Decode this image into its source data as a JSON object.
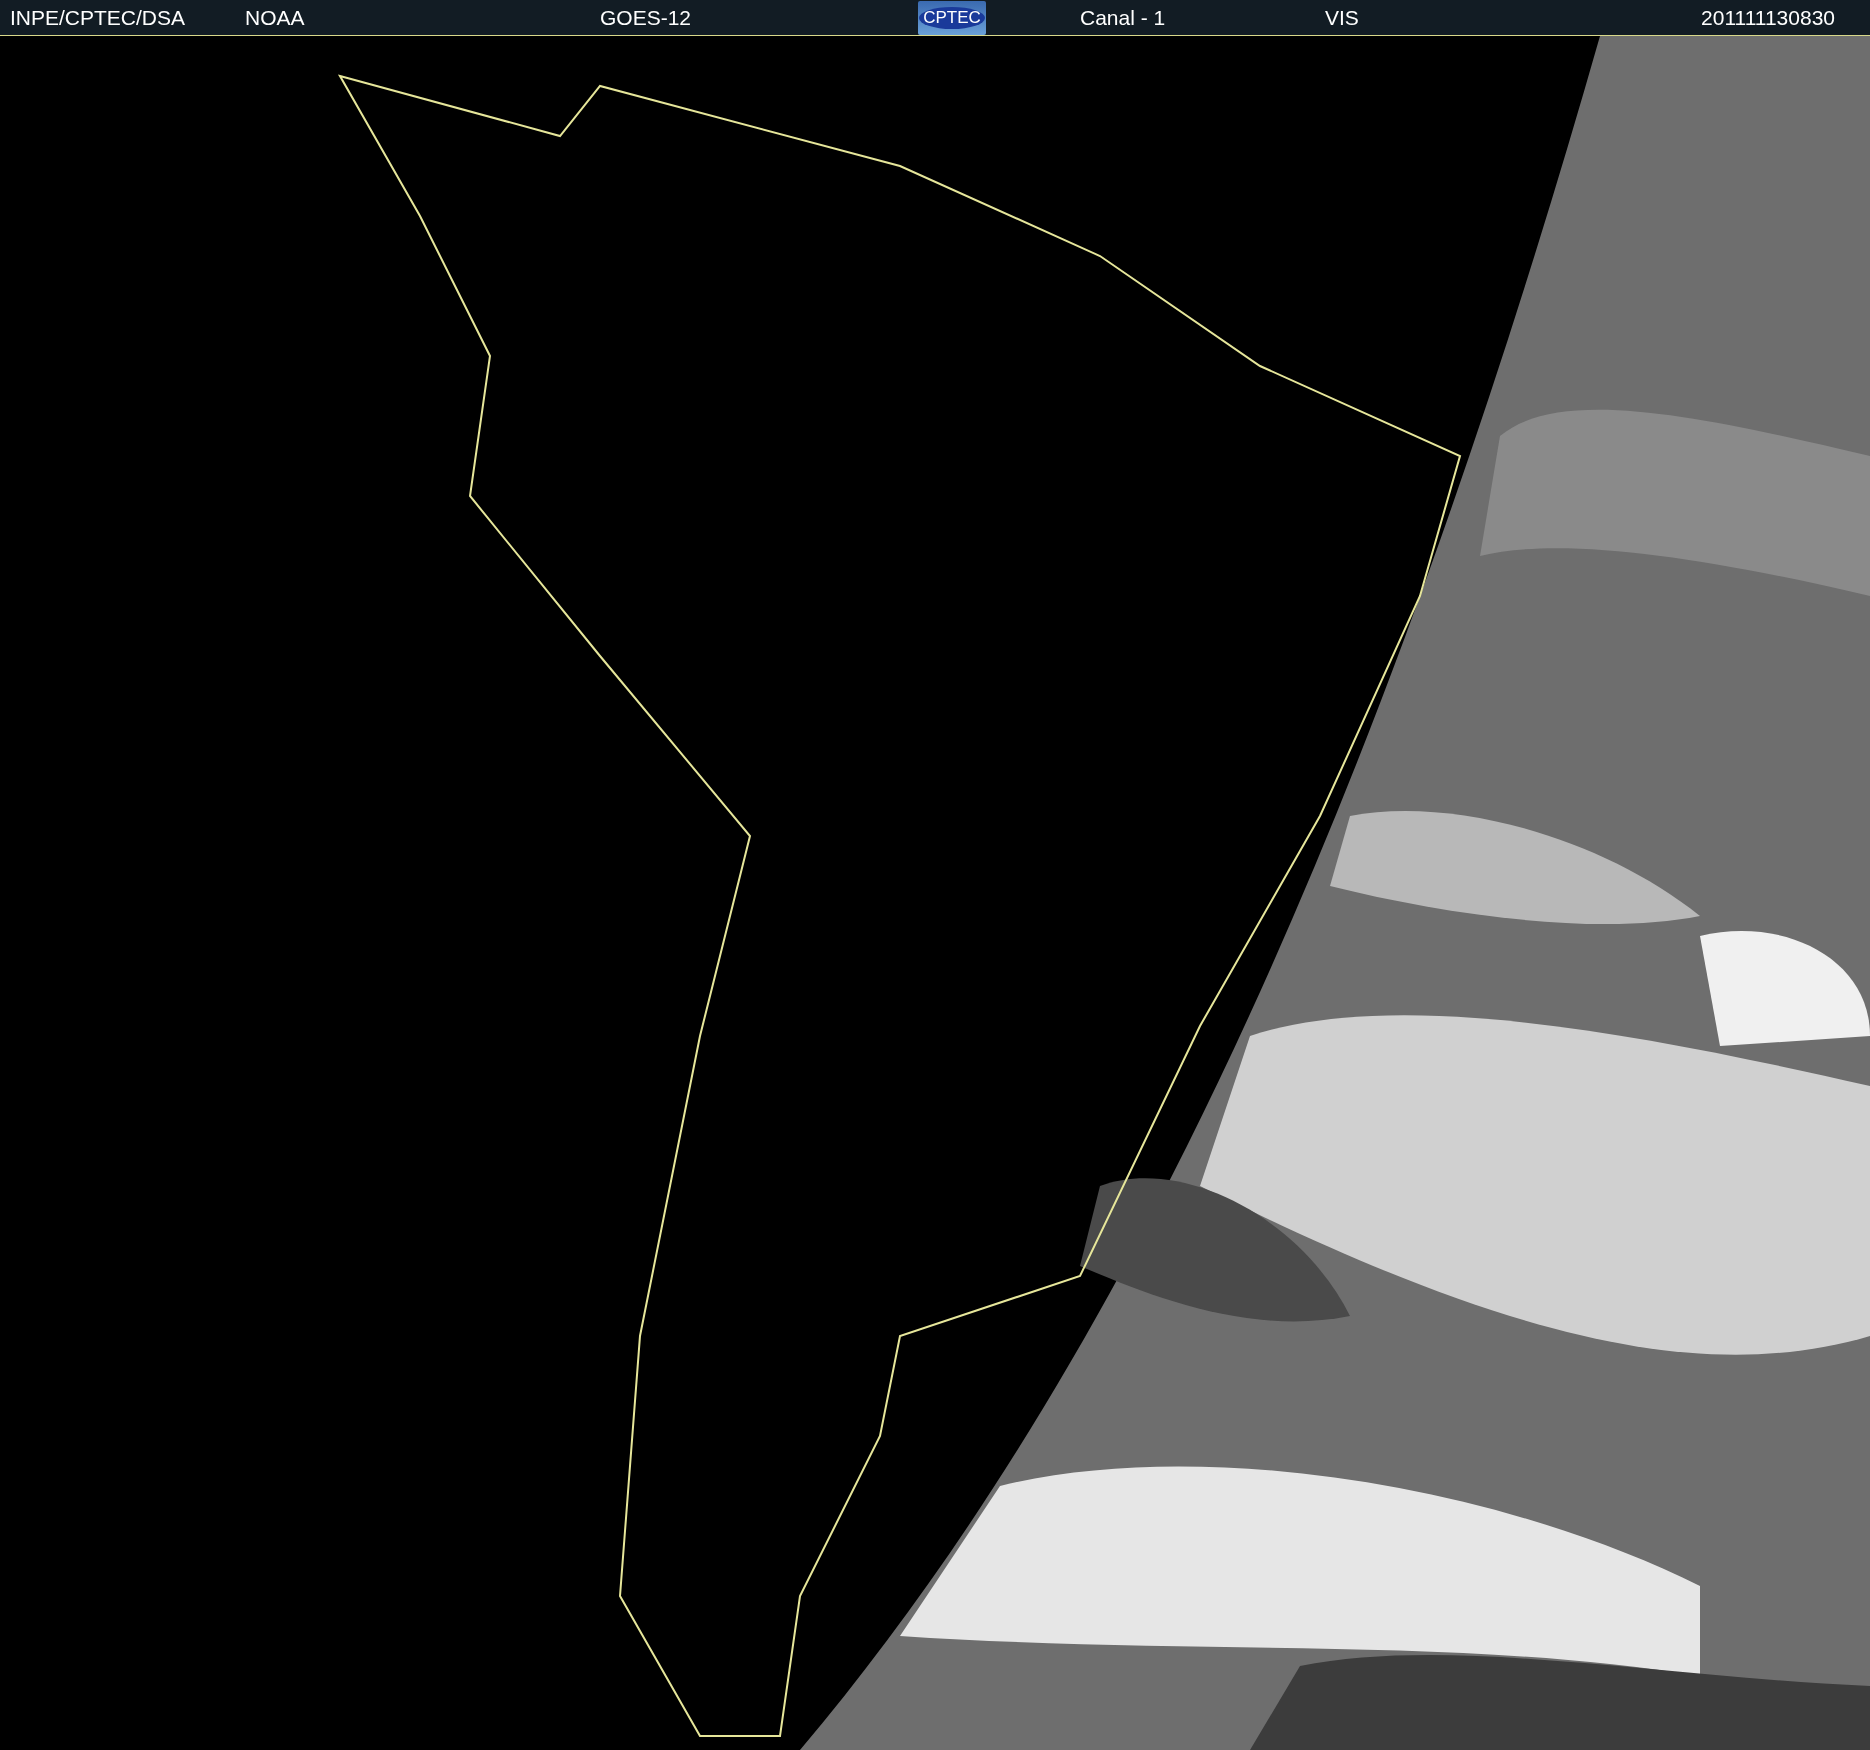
{
  "header": {
    "items": [
      {
        "kind": "text",
        "text": "INPE/CPTEC/DSA"
      },
      {
        "kind": "text",
        "text": "NOAA"
      },
      {
        "kind": "text",
        "text": "GOES-12"
      },
      {
        "kind": "logo",
        "text": "CPTEC"
      },
      {
        "kind": "text",
        "text": "Canal - 1"
      },
      {
        "kind": "text",
        "text": "VIS"
      },
      {
        "kind": "text",
        "text": "201111130830"
      }
    ]
  }
}
